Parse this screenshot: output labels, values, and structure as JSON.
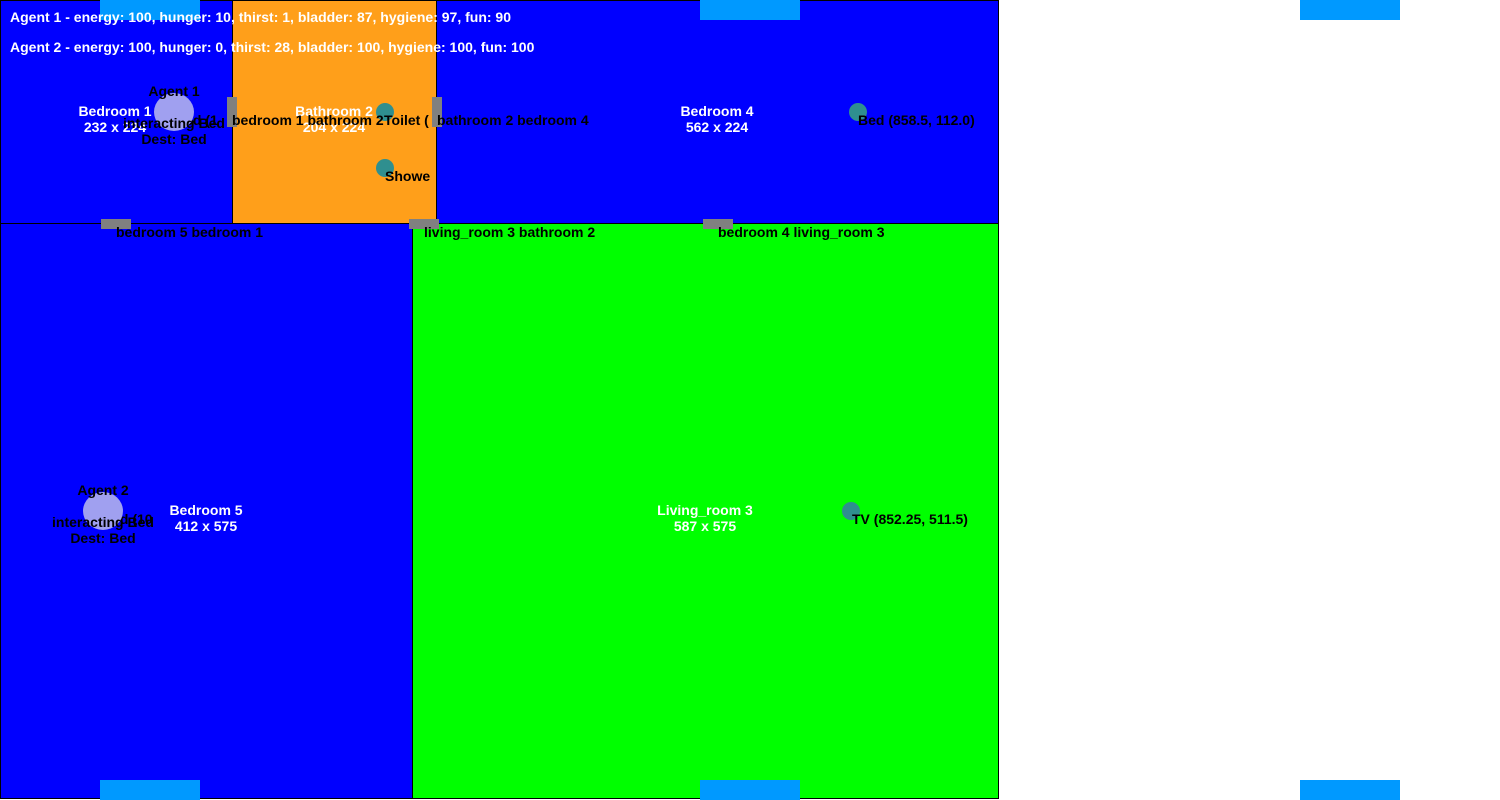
{
  "stats": {
    "agent1": "Agent 1 - energy: 100, hunger: 10, thirst: 1, bladder: 87, hygiene: 97, fun: 90",
    "agent2": "Agent 2 - energy: 100, hunger: 0, thirst: 28, bladder: 100, hygiene: 100, fun: 100"
  },
  "colors": {
    "bedroom": "#0000ff",
    "bathroom": "#ff9f1a",
    "living_room": "#00ff00",
    "door": "#808080",
    "window": "#0099ff",
    "object": "#2f8f8f",
    "agent": "#a0a0f0"
  },
  "rooms": {
    "bedroom1": {
      "name": "Bedroom 1",
      "size": "232 x 224"
    },
    "bathroom2": {
      "name": "Bathroom 2",
      "size": "204 x 224"
    },
    "bedroom4": {
      "name": "Bedroom 4",
      "size": "562 x 224"
    },
    "bedroom5": {
      "name": "Bedroom 5",
      "size": "412 x 575"
    },
    "living_room3": {
      "name": "Living_room 3",
      "size": "587 x 575"
    }
  },
  "doors": {
    "bedroom1_bathroom2": "bedroom 1 bathroom 2",
    "bathroom2_bedroom4": "bathroom 2 bedroom 4",
    "bedroom5_bedroom1": "bedroom 5 bedroom 1",
    "living3_bathroom2": "living_room 3 bathroom 2",
    "bedroom4_living3": "bedroom 4 living_room 3"
  },
  "objects": {
    "bed1": "Bed (1",
    "toilet": "Toilet (",
    "shower": "Showe",
    "bed4": "Bed (858.5, 112.0)",
    "bed5": "Bed (10",
    "tv": "TV (852.25, 511.5)"
  },
  "agents": {
    "agent1": {
      "name": "Agent 1",
      "status": "interacting Bed",
      "dest": "Dest: Bed"
    },
    "agent2": {
      "name": "Agent 2",
      "status": "interacting Bed",
      "dest": "Dest: Bed"
    }
  }
}
